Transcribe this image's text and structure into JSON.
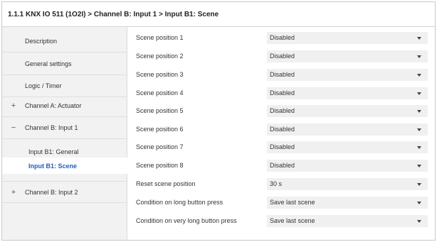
{
  "header": {
    "breadcrumb": "1.1.1 KNX IO 511 (1O2I) > Channel B: Input 1 > Input B1: Scene"
  },
  "sidebar": {
    "items": [
      {
        "sign": "",
        "label": "Description"
      },
      {
        "sign": "",
        "label": "General settings"
      },
      {
        "sign": "",
        "label": "Logic / Timer"
      },
      {
        "sign": "+",
        "label": "Channel A: Actuator"
      },
      {
        "sign": "−",
        "label": "Channel B: Input 1"
      },
      {
        "sign": "",
        "label": "Input B1: General"
      },
      {
        "sign": "",
        "label": "Input B1: Scene"
      },
      {
        "sign": "+",
        "label": "Channel B: Input 2"
      }
    ],
    "active_index": 6
  },
  "params": [
    {
      "label": "Scene position 1",
      "value": "Disabled"
    },
    {
      "label": "Scene position 2",
      "value": "Disabled"
    },
    {
      "label": "Scene position 3",
      "value": "Disabled"
    },
    {
      "label": "Scene position 4",
      "value": "Disabled"
    },
    {
      "label": "Scene position 5",
      "value": "Disabled"
    },
    {
      "label": "Scene position 6",
      "value": "Disabled"
    },
    {
      "label": "Scene position 7",
      "value": "Disabled"
    },
    {
      "label": "Scene position 8",
      "value": "Disabled"
    },
    {
      "label": "Reset scene position",
      "value": "30 s"
    },
    {
      "label": "Condition on long button press",
      "value": "Save last scene"
    },
    {
      "label": "Condition on very long button press",
      "value": "Save last scene"
    }
  ],
  "colors": {
    "active_text": "#1f5fbf",
    "sidebar_bg": "#f2f2f2",
    "select_bg": "#f0f0f0"
  }
}
